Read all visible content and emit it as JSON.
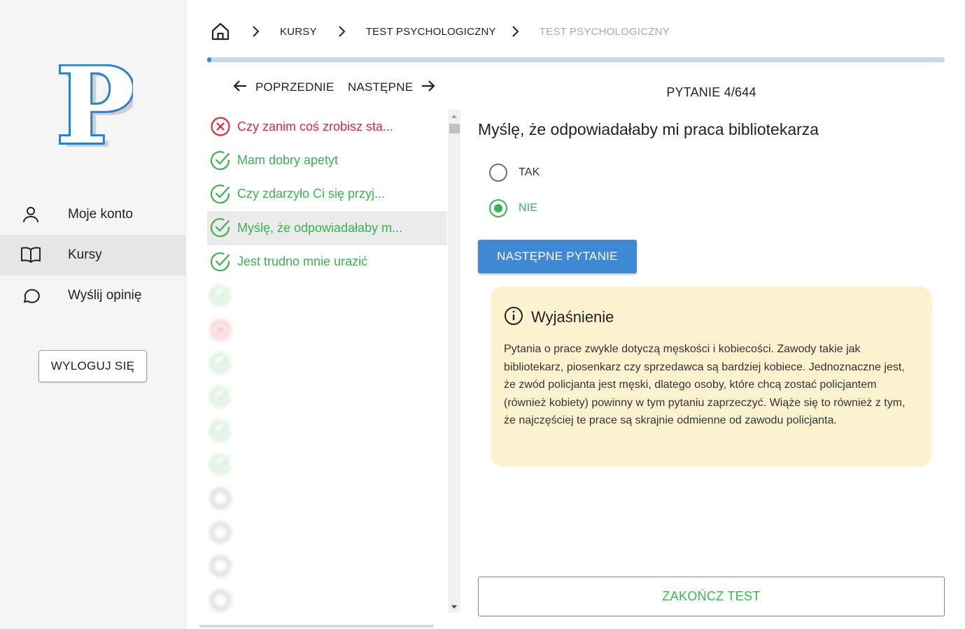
{
  "sidebar": {
    "logo_letter": "P",
    "nav": [
      {
        "label": "Moje konto",
        "icon": "user-icon"
      },
      {
        "label": "Kursy",
        "icon": "book-icon"
      },
      {
        "label": "Wyślij opinię",
        "icon": "chat-bubble-icon"
      }
    ],
    "logout_label": "WYLOGUJ SIĘ"
  },
  "breadcrumb": {
    "items": [
      "KURSY",
      "TEST PSYCHOLOGICZNY",
      "TEST PSYCHOLOGICZNY"
    ]
  },
  "progress_fraction": 0.006,
  "navigation": {
    "prev_label": "POPRZEDNIE",
    "next_label": "NASTĘPNE"
  },
  "question_list": [
    {
      "text": "Czy zanim coś zrobisz sta...",
      "status": "wrong"
    },
    {
      "text": "Mam dobry apetyt",
      "status": "correct"
    },
    {
      "text": "Czy zdarzyło Ci się przyj...",
      "status": "correct"
    },
    {
      "text": "Myślę, że odpowiadałaby m...",
      "status": "correct"
    },
    {
      "text": "Jest trudno mnie urazić",
      "status": "correct"
    },
    {
      "text": "",
      "status": "correct"
    },
    {
      "text": "",
      "status": "wrong"
    },
    {
      "text": "",
      "status": "correct"
    },
    {
      "text": "",
      "status": "correct"
    },
    {
      "text": "",
      "status": "correct"
    },
    {
      "text": "",
      "status": "correct"
    },
    {
      "text": "",
      "status": "pending"
    },
    {
      "text": "",
      "status": "pending"
    },
    {
      "text": "",
      "status": "pending"
    },
    {
      "text": "",
      "status": "pending"
    }
  ],
  "question": {
    "counter": "PYTANIE 4/644",
    "title": "Myślę, że odpowiadałaby mi praca bibliotekarza",
    "options": [
      {
        "label": "TAK",
        "selected": false
      },
      {
        "label": "NIE",
        "selected": true
      }
    ],
    "next_question_label": "NASTĘPNE PYTANIE"
  },
  "explanation": {
    "title": "Wyjaśnienie",
    "body": "Pytania o prace zwykle dotyczą męskości i kobiecości. Zawody takie jak bibliotekarz, piosenkarz czy sprzedawca są bardziej kobiece. Jednoznaczne jest, że zwód policjanta jest męski, dlatego osoby, które chcą zostać policjantem (również kobiety) powinny w tym pytaniu zaprzeczyć. Wiąże się to również z tym, że najczęściej te prace są skrajnie odmienne od zawodu policjanta."
  },
  "finish_label": "ZAKOŃCZ TEST",
  "colors": {
    "primary_blue": "#3f88d3",
    "success_green": "#3cb251",
    "error_red": "#e0283d",
    "explanation_bg": "#fdf2d0"
  }
}
